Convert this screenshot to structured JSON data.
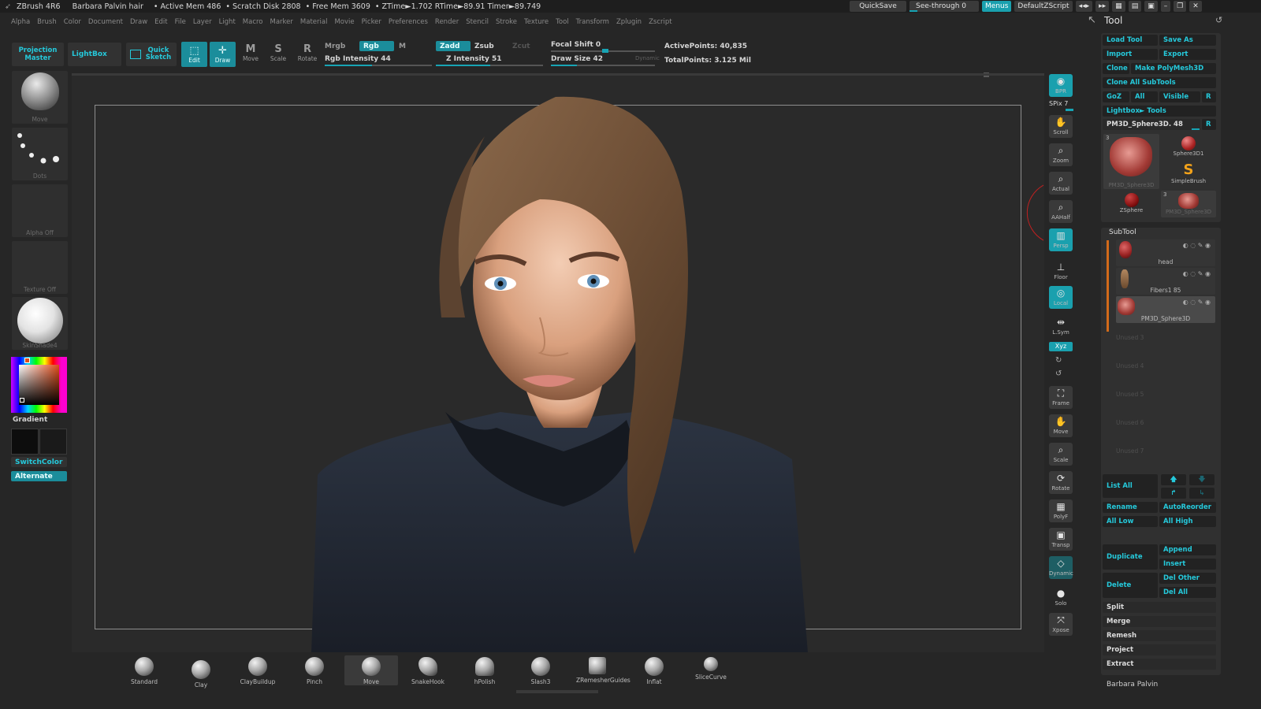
{
  "titlebar": {
    "app": "ZBrush 4R6",
    "document": "Barbara Palvin hair",
    "active_mem": "• Active Mem 486",
    "scratch": "• Scratch Disk 2808",
    "free_mem": "• Free Mem 3609",
    "ztime": "• ZTime►1.702 RTime►89.91 Timer►89.749",
    "quicksave": "QuickSave",
    "see_through": "See-through",
    "see_through_value": "0",
    "menus": "Menus",
    "default_zscript": "DefaultZScript"
  },
  "menubar": [
    "Alpha",
    "Brush",
    "Color",
    "Document",
    "Draw",
    "Edit",
    "File",
    "Layer",
    "Light",
    "Macro",
    "Marker",
    "Material",
    "Movie",
    "Picker",
    "Preferences",
    "Render",
    "Stencil",
    "Stroke",
    "Texture",
    "Tool",
    "Transform",
    "Zplugin",
    "Zscript"
  ],
  "topshelf": {
    "projection_master": "Projection Master",
    "lightbox": "LightBox",
    "quick_sketch": "Quick Sketch",
    "edit": "Edit",
    "draw": "Draw",
    "move": "Move",
    "scale": "Scale",
    "rotate": "Rotate",
    "mrgb": "Mrgb",
    "rgb": "Rgb",
    "m": "M",
    "rgb_intensity": "Rgb Intensity 44",
    "zadd": "Zadd",
    "zsub": "Zsub",
    "zcut": "Zcut",
    "z_intensity": "Z Intensity 51",
    "focal_shift": "Focal Shift 0",
    "draw_size": "Draw Size 42",
    "dynamic": "Dynamic",
    "active_points": "ActivePoints: 40,835",
    "total_points": "TotalPoints: 3.125 Mil",
    "rgb_intensity_value": 44,
    "z_intensity_value": 51,
    "draw_size_fraction": 0.1
  },
  "leftshelf": {
    "thumbs": [
      "Move",
      "Dots",
      "Alpha Off",
      "Texture Off",
      "SkinShade4"
    ],
    "gradient": "Gradient",
    "switch_color": "SwitchColor",
    "alternate": "Alternate"
  },
  "rightshelf": [
    {
      "label": "BPR",
      "icon": "render-icon"
    },
    {
      "label": "Scroll",
      "icon": "scroll-icon"
    },
    {
      "label": "Zoom",
      "icon": "zoom-icon"
    },
    {
      "label": "Actual",
      "icon": "actual-icon"
    },
    {
      "label": "AAHalf",
      "icon": "aahalf-icon"
    },
    {
      "label": "Persp",
      "icon": "persp-icon"
    },
    {
      "label": "Floor",
      "icon": "floor-icon"
    },
    {
      "label": "Local",
      "icon": "local-icon"
    },
    {
      "label": "L.Sym",
      "icon": "lsym-icon"
    },
    {
      "label": "Frame",
      "icon": "frame-icon"
    },
    {
      "label": "Move",
      "icon": "move-icon"
    },
    {
      "label": "Scale",
      "icon": "scale-icon"
    },
    {
      "label": "Rotate",
      "icon": "rotate-icon"
    },
    {
      "label": "PolyF",
      "icon": "polyf-icon"
    },
    {
      "label": "Transp",
      "icon": "transp-icon"
    },
    {
      "label": "Dynamic",
      "icon": "ghost-icon"
    },
    {
      "label": "Solo",
      "icon": "solo-icon"
    },
    {
      "label": "Xpose",
      "icon": "xpose-icon"
    }
  ],
  "spix": "SPix 7",
  "xyz": "Xyz",
  "tool": {
    "title": "Tool",
    "load_tool": "Load Tool",
    "save_as": "Save As",
    "import": "Import",
    "export": "Export",
    "clone": "Clone",
    "make_polymesh": "Make PolyMesh3D",
    "clone_all": "Clone All SubTools",
    "goz": "GoZ",
    "all": "All",
    "visible": "Visible",
    "r": "R",
    "lightbox_tools": "Lightbox► Tools",
    "current_tool": "PM3D_Sphere3D. 48",
    "thumbs": [
      "PM3D_Sphere3D",
      "Sphere3D1",
      "SimpleBrush",
      "ZSphere",
      "PM3D_Sphere3D"
    ],
    "thumb_badge_1": "3",
    "thumb_badge_5": "3"
  },
  "subtool": {
    "title": "SubTool",
    "items": [
      "head",
      "Fibers1 85",
      "PM3D_Sphere3D"
    ],
    "unused": [
      "Unused 3",
      "Unused 4",
      "Unused 5",
      "Unused 6",
      "Unused 7"
    ],
    "list_all": "List All",
    "rename": "Rename",
    "auto_reorder": "AutoReorder",
    "all_low": "All Low",
    "all_high": "All High",
    "duplicate": "Duplicate",
    "append": "Append",
    "insert": "Insert",
    "delete": "Delete",
    "del_other": "Del Other",
    "del_all": "Del All",
    "split": "Split",
    "merge": "Merge",
    "remesh": "Remesh",
    "project": "Project",
    "extract": "Extract"
  },
  "footer_name": "Barbara Palvin",
  "brushes": [
    "Standard",
    "Clay",
    "ClayBuildup",
    "Pinch",
    "Move",
    "SnakeHook",
    "hPolish",
    "Slash3",
    "ZRemesherGuides",
    "Inflat",
    "SliceCurve"
  ]
}
